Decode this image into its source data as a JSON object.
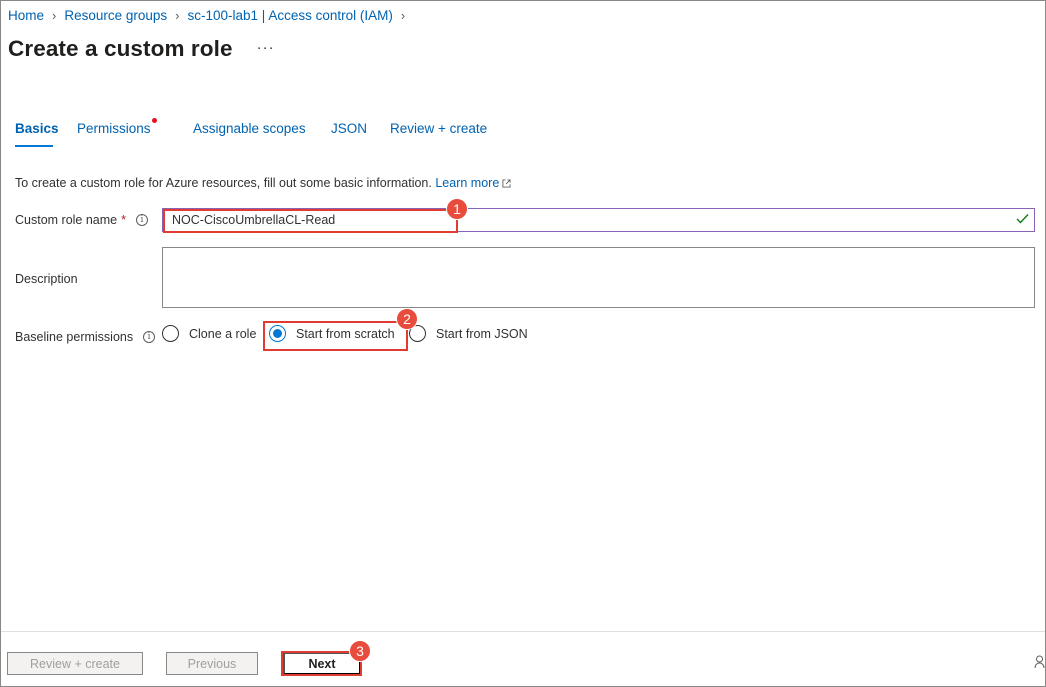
{
  "breadcrumb": [
    "Home",
    "Resource groups",
    "sc-100-lab1 | Access control (IAM)"
  ],
  "page": {
    "title": "Create a custom role",
    "more_label": "···"
  },
  "tabs": [
    {
      "label": "Basics",
      "active": true
    },
    {
      "label": "Permissions",
      "required_dot": true
    },
    {
      "label": "Assignable scopes"
    },
    {
      "label": "JSON"
    },
    {
      "label": "Review + create"
    }
  ],
  "intro": {
    "text": "To create a custom role for Azure resources, fill out some basic information.",
    "link": "Learn more"
  },
  "form": {
    "role_name_label": "Custom role name",
    "required_mark": "*",
    "role_name_value": "NOC-CiscoUmbrellaCL-Read",
    "description_label": "Description",
    "description_value": "",
    "baseline_label": "Baseline permissions",
    "baseline_options": [
      "Clone a role",
      "Start from scratch",
      "Start from JSON"
    ],
    "baseline_selected": "Start from scratch"
  },
  "annotations": [
    "1",
    "2",
    "3"
  ],
  "footer": {
    "review_create": "Review + create",
    "previous": "Previous",
    "next": "Next"
  },
  "colors": {
    "link": "#0063b1",
    "accent": "#0078d4",
    "valid_border": "#8764b8",
    "highlight": "#e03c31",
    "badge": "#e74c3c",
    "check": "#107c10"
  },
  "icons": {
    "info": "info-icon",
    "external_link": "external-link-icon",
    "valid": "checkmark-icon",
    "corner": "person-icon"
  }
}
